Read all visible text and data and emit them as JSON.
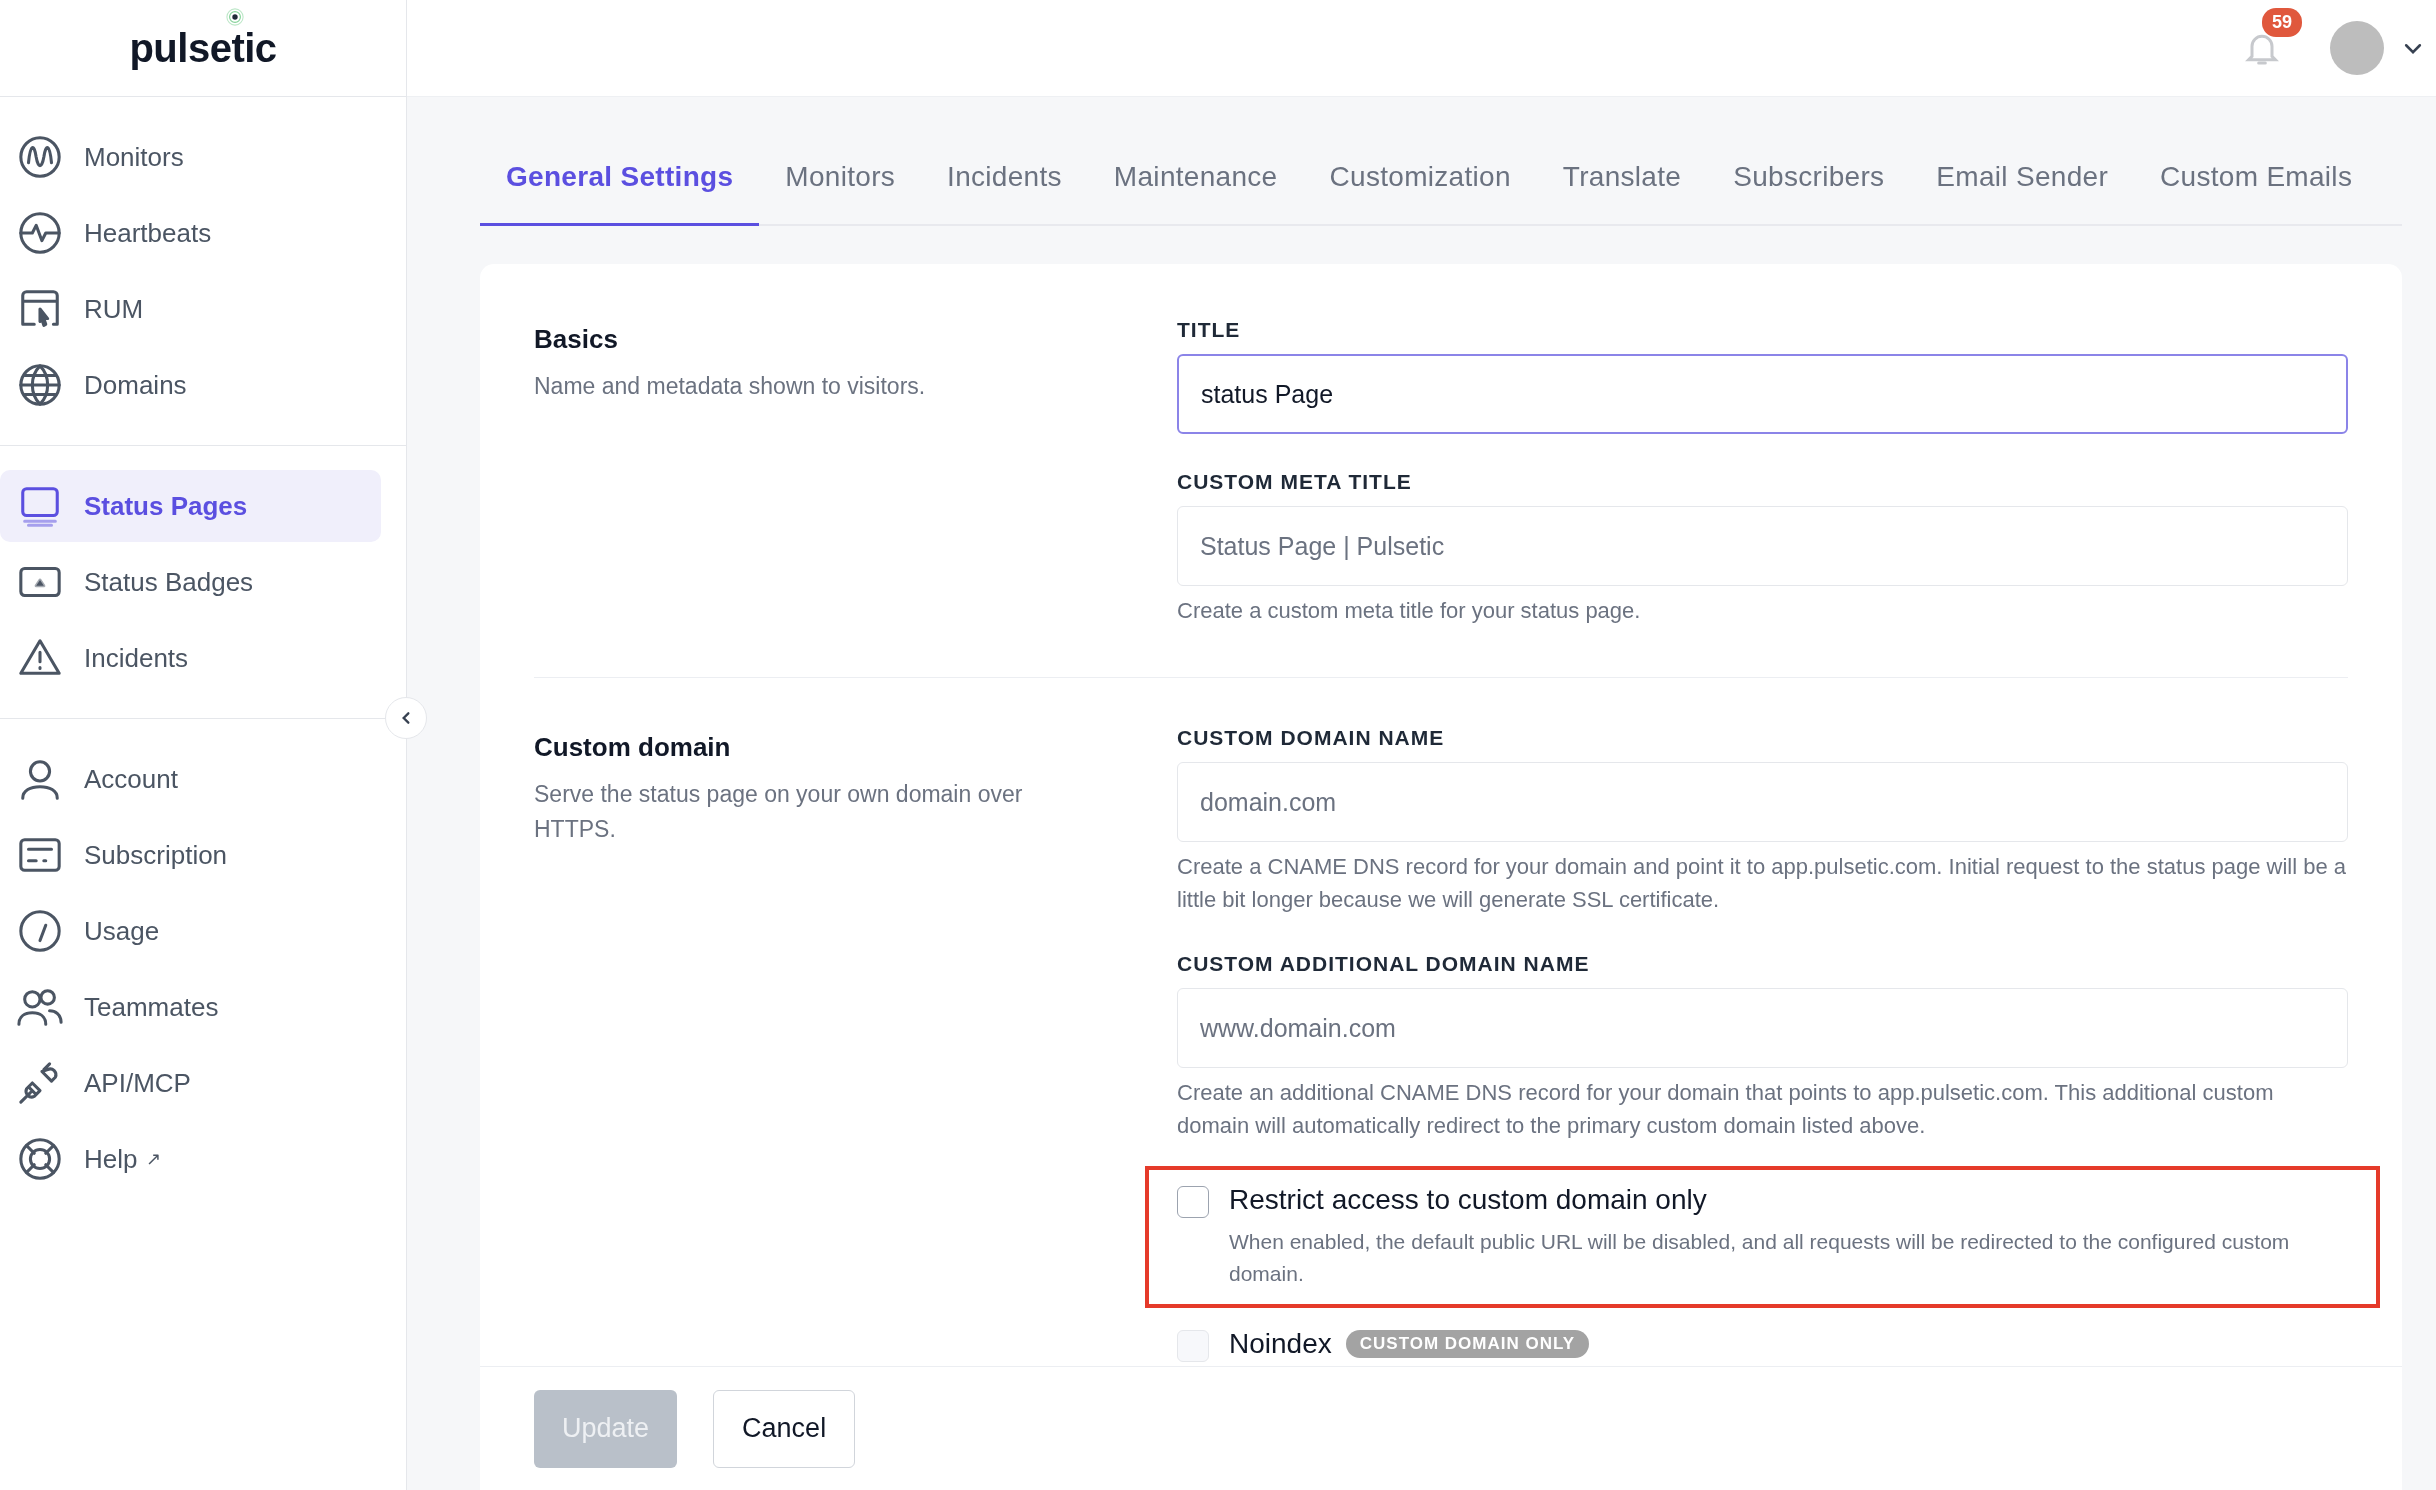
{
  "brand": {
    "logo": "pulsetic"
  },
  "sidebar": {
    "groups": [
      {
        "items": [
          {
            "kind": "monitors",
            "label": "Monitors",
            "selected": false
          },
          {
            "kind": "heartbeats",
            "label": "Heartbeats",
            "selected": false
          },
          {
            "kind": "rum",
            "label": "RUM",
            "selected": false
          },
          {
            "kind": "domains",
            "label": "Domains",
            "selected": false
          }
        ]
      },
      {
        "items": [
          {
            "kind": "status-pages",
            "label": "Status Pages",
            "selected": true
          },
          {
            "kind": "status-badges",
            "label": "Status Badges",
            "selected": false
          },
          {
            "kind": "incidents",
            "label": "Incidents",
            "selected": false
          }
        ]
      },
      {
        "items": [
          {
            "kind": "account",
            "label": "Account",
            "selected": false
          },
          {
            "kind": "subscription",
            "label": "Subscription",
            "selected": false
          },
          {
            "kind": "usage",
            "label": "Usage",
            "selected": false
          },
          {
            "kind": "teammates",
            "label": "Teammates",
            "selected": false
          },
          {
            "kind": "api",
            "label": "API/MCP",
            "selected": false
          },
          {
            "kind": "help",
            "label": "Help",
            "suffix": "↗",
            "selected": false
          }
        ]
      }
    ]
  },
  "header": {
    "notifications": "59"
  },
  "tabs": [
    {
      "label": "General Settings",
      "selected": true
    },
    {
      "label": "Monitors",
      "selected": false
    },
    {
      "label": "Incidents",
      "selected": false
    },
    {
      "label": "Maintenance",
      "selected": false
    },
    {
      "label": "Customization",
      "selected": false
    },
    {
      "label": "Translate",
      "selected": false
    },
    {
      "label": "Subscribers",
      "selected": false
    },
    {
      "label": "Email Sender",
      "selected": false
    },
    {
      "label": "Custom Emails",
      "selected": false
    }
  ],
  "sections": [
    {
      "title": "Basics",
      "description": "Name and metadata shown to visitors.",
      "fields": [
        {
          "label": "TITLE",
          "value": "status Page",
          "focused": true
        },
        {
          "label": "CUSTOM META TITLE",
          "placeholder": "Status Page | Pulsetic",
          "focused": false,
          "help": "Create a custom meta title for your status page."
        }
      ]
    },
    {
      "title": "Custom domain",
      "description": "Serve the status page on your own domain over HTTPS.",
      "fields": [
        {
          "label": "CUSTOM DOMAIN NAME",
          "placeholder": "domain.com",
          "focused": false,
          "help": "Create a CNAME DNS record for your domain and point it to app.pulsetic.com. Initial request to the status page will be a little bit longer because we will generate SSL certificate."
        },
        {
          "label": "CUSTOM ADDITIONAL DOMAIN NAME",
          "placeholder": "www.domain.com",
          "focused": false,
          "help": "Create an additional CNAME DNS record for your domain that points to app.pulsetic.com. This additional custom domain will automatically redirect to the primary custom domain listed above."
        }
      ],
      "options": [
        {
          "label": "Restrict access to custom domain only",
          "description": "When enabled, the default public URL will be disabled, and all requests will be redirected to the configured custom domain.",
          "checked": false,
          "highlighted": true
        },
        {
          "label": "Noindex",
          "badge": "CUSTOM DOMAIN ONLY",
          "checked": false,
          "highlighted": false
        }
      ]
    }
  ],
  "footer": {
    "buttons": [
      {
        "label": "Update",
        "kind": "primary",
        "disabled": true
      },
      {
        "label": "Cancel",
        "kind": "secondary",
        "disabled": false
      }
    ]
  }
}
